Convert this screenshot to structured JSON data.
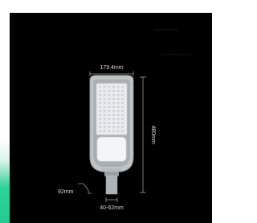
{
  "dimensions": {
    "width_label": "179.4mm",
    "height_label": "480mm",
    "depth_label": "92mm",
    "pole_label": "40-62mm"
  },
  "colors": {
    "panel": "#000000",
    "accent": "#27c98f",
    "housing": "#bfc4c7",
    "housing_rim": "#8f969a",
    "led_panel": "#e9ecef",
    "driver_cover": "#f4f5f6",
    "dimension_line": "#9a9a9a",
    "label_text": "#d8d8d8"
  },
  "icons": [
    "street-light-product",
    "dimension-arrows"
  ]
}
